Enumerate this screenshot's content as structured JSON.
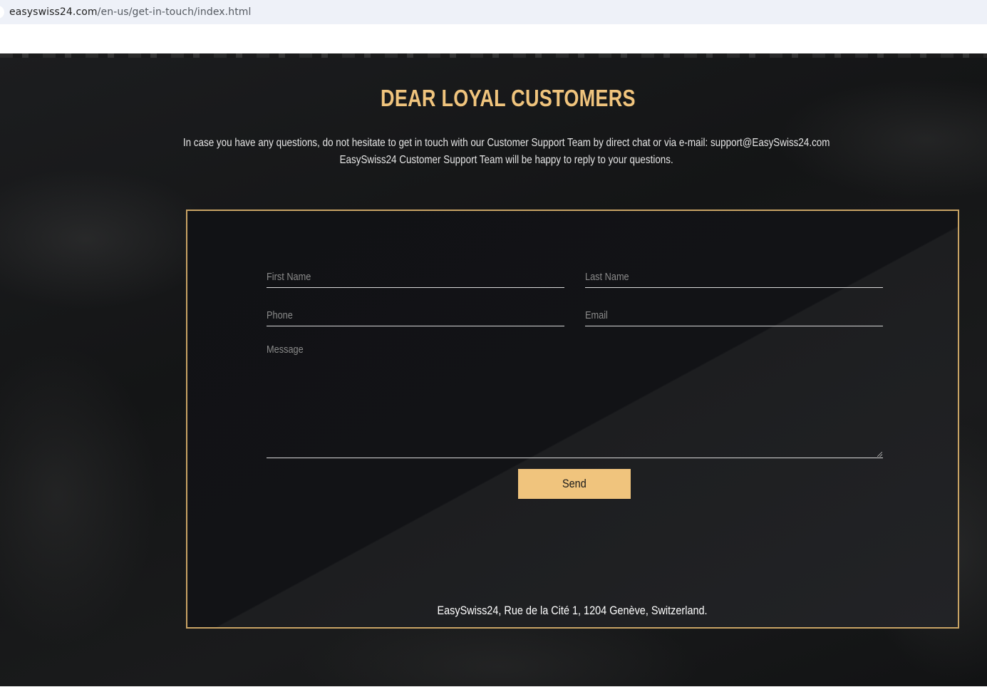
{
  "browser": {
    "url_host": "easyswiss24.com",
    "url_path": "/en-us/get-in-touch/index.html"
  },
  "header": {
    "title": "DEAR LOYAL CUSTOMERS",
    "intro_line1": "In case you have any questions, do not hesitate to get in touch with our Customer Support Team by direct chat or via e-mail: support@EasySwiss24.com",
    "intro_line2": "EasySwiss24 Customer Support Team will be happy to reply to your questions."
  },
  "form": {
    "first_name_placeholder": "First Name",
    "last_name_placeholder": "Last Name",
    "phone_placeholder": "Phone",
    "email_placeholder": "Email",
    "message_placeholder": "Message",
    "send_label": "Send",
    "company_address": "EasySwiss24, Rue de la Cité 1, 1204 Genève, Switzerland."
  },
  "colors": {
    "accent": "#f0c47d",
    "background": "#151618",
    "card_border": "#c8a364"
  }
}
